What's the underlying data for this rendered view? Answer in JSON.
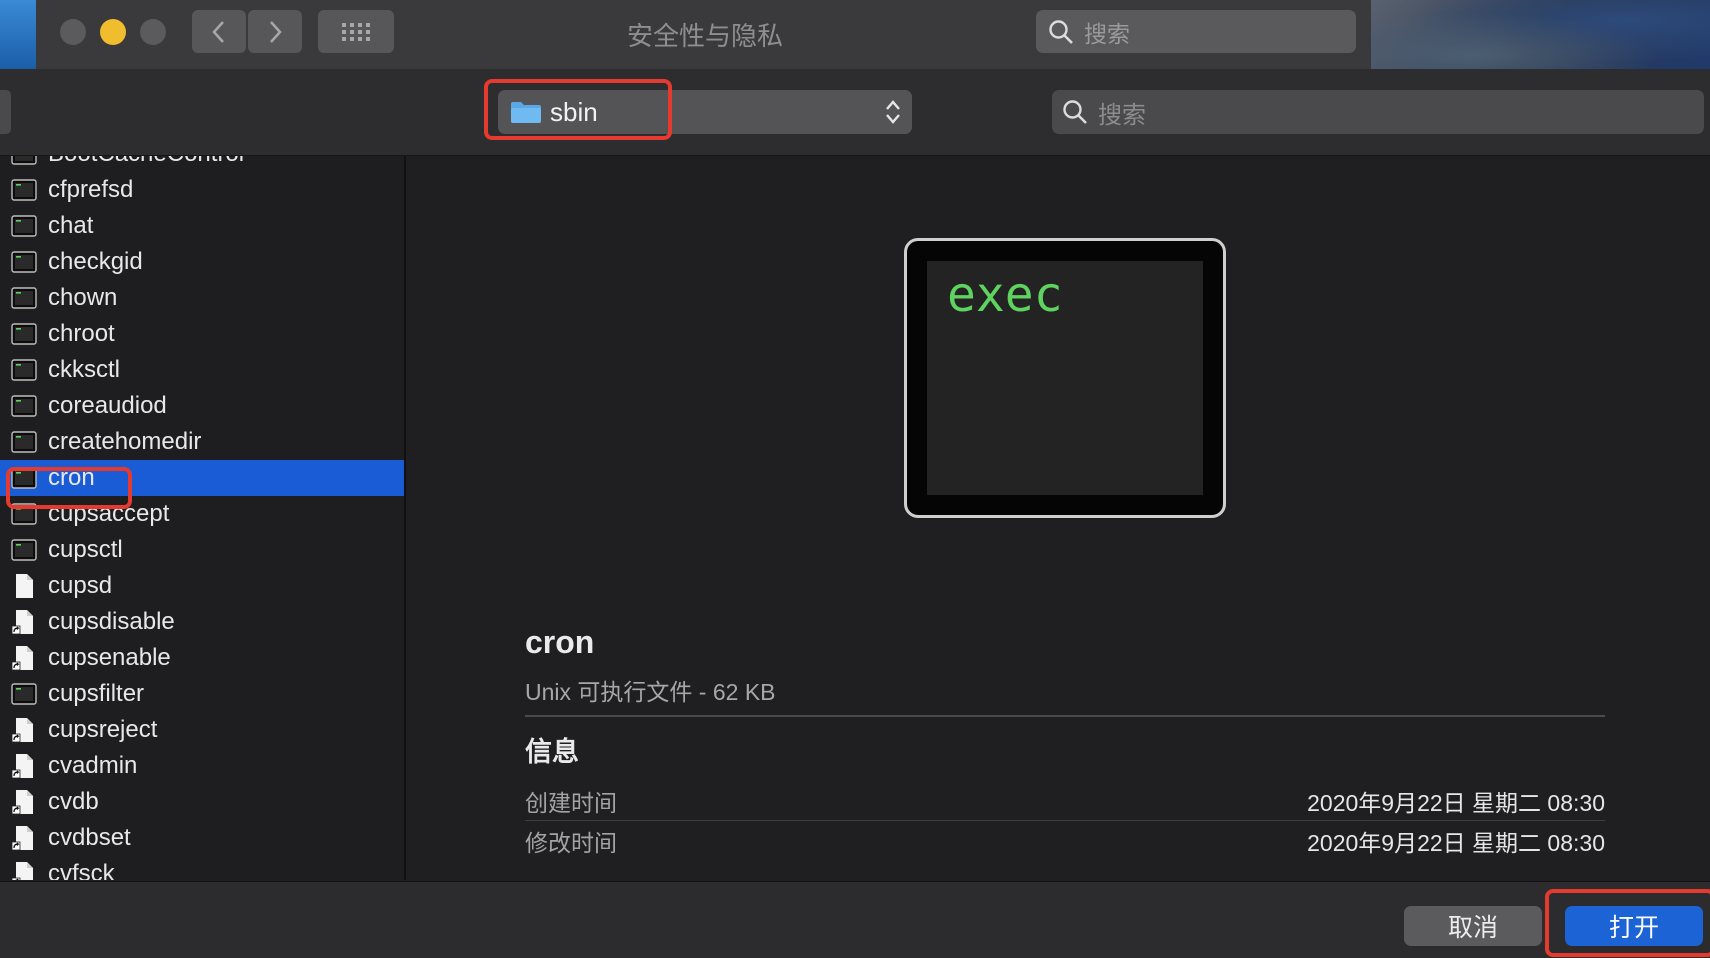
{
  "background_window": {
    "title": "安全性与隐私",
    "search_placeholder": "搜索"
  },
  "dialog": {
    "path_popup": {
      "folder_name": "sbin",
      "icon": "folder-icon"
    },
    "search_placeholder": "搜索",
    "files": [
      {
        "name": "BootCacheControl",
        "icon": "terminal-exec-icon",
        "selected": false
      },
      {
        "name": "cfprefsd",
        "icon": "terminal-exec-icon",
        "selected": false
      },
      {
        "name": "chat",
        "icon": "terminal-exec-icon",
        "selected": false
      },
      {
        "name": "checkgid",
        "icon": "terminal-exec-icon",
        "selected": false
      },
      {
        "name": "chown",
        "icon": "terminal-exec-icon",
        "selected": false
      },
      {
        "name": "chroot",
        "icon": "terminal-exec-icon",
        "selected": false
      },
      {
        "name": "ckksctl",
        "icon": "terminal-exec-icon",
        "selected": false
      },
      {
        "name": "coreaudiod",
        "icon": "terminal-exec-icon",
        "selected": false
      },
      {
        "name": "createhomedir",
        "icon": "terminal-exec-icon",
        "selected": false
      },
      {
        "name": "cron",
        "icon": "terminal-exec-icon",
        "selected": true
      },
      {
        "name": "cupsaccept",
        "icon": "terminal-exec-icon",
        "selected": false
      },
      {
        "name": "cupsctl",
        "icon": "terminal-exec-icon",
        "selected": false
      },
      {
        "name": "cupsd",
        "icon": "document-icon",
        "selected": false
      },
      {
        "name": "cupsdisable",
        "icon": "alias-document-icon",
        "selected": false
      },
      {
        "name": "cupsenable",
        "icon": "alias-document-icon",
        "selected": false
      },
      {
        "name": "cupsfilter",
        "icon": "terminal-exec-icon",
        "selected": false
      },
      {
        "name": "cupsreject",
        "icon": "alias-document-icon",
        "selected": false
      },
      {
        "name": "cvadmin",
        "icon": "alias-document-icon",
        "selected": false
      },
      {
        "name": "cvdb",
        "icon": "alias-document-icon",
        "selected": false
      },
      {
        "name": "cvdbset",
        "icon": "alias-document-icon",
        "selected": false
      },
      {
        "name": "cvfsck",
        "icon": "alias-document-icon",
        "selected": false
      }
    ],
    "preview": {
      "icon_text": "exec",
      "file_name": "cron",
      "kind": "Unix 可执行文件 - 62 KB",
      "info_title": "信息",
      "created_label": "创建时间",
      "created_value": "2020年9月22日 星期二 08:30",
      "modified_label": "修改时间",
      "modified_value": "2020年9月22日 星期二 08:30"
    },
    "buttons": {
      "cancel": "取消",
      "open": "打开"
    }
  },
  "colors": {
    "selection": "#1a5bd6",
    "primary_button": "#1c63d6",
    "highlight": "#e53a2f",
    "exec_text": "#5fd35f"
  }
}
